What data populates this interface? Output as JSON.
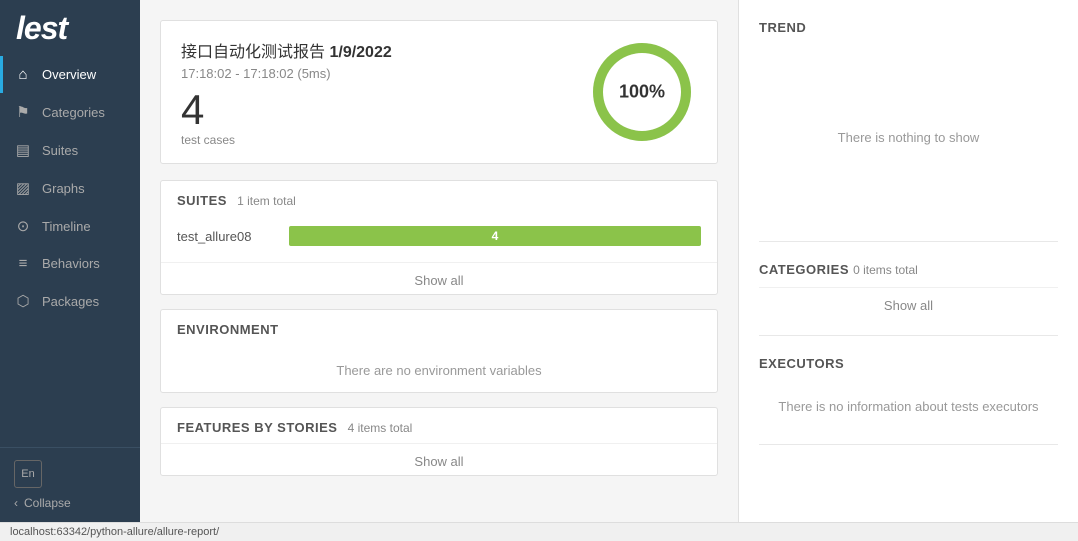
{
  "logo": {
    "text": "lest"
  },
  "sidebar": {
    "items": [
      {
        "id": "overview",
        "label": "Overview",
        "icon": "⌂",
        "active": true
      },
      {
        "id": "categories",
        "label": "Categories",
        "icon": "⚑",
        "active": false
      },
      {
        "id": "suites",
        "label": "Suites",
        "icon": "▤",
        "active": false
      },
      {
        "id": "graphs",
        "label": "Graphs",
        "icon": "▨",
        "active": false
      },
      {
        "id": "timeline",
        "label": "Timeline",
        "icon": "⊙",
        "active": false
      },
      {
        "id": "behaviors",
        "label": "Behaviors",
        "icon": "≡",
        "active": false
      },
      {
        "id": "packages",
        "label": "Packages",
        "icon": "⬡",
        "active": false
      }
    ],
    "lang_label": "En",
    "collapse_label": "Collapse"
  },
  "report": {
    "title": "接口自动化测试报告",
    "date": "1/9/2022",
    "time_range": "17:18:02 - 17:18:02 (5ms)",
    "test_count": "4",
    "test_cases_label": "test cases",
    "pass_percent": "100%"
  },
  "suites": {
    "title": "SUITES",
    "count_label": "1 item total",
    "rows": [
      {
        "name": "test_allure08",
        "value": 4,
        "max": 4
      }
    ],
    "show_all_label": "Show all"
  },
  "environment": {
    "title": "ENVIRONMENT",
    "empty_message": "There are no environment variables"
  },
  "features": {
    "title": "FEATURES BY STORIES",
    "count_label": "4 items total",
    "show_all_label": "Show all"
  },
  "trend": {
    "title": "TREND",
    "empty_message": "There is nothing to show"
  },
  "categories": {
    "title": "CATEGORIES",
    "count_label": "0 items total",
    "show_all_label": "Show all"
  },
  "executors": {
    "title": "EXECUTORS",
    "empty_message": "There is no information about tests executors"
  },
  "status_bar": {
    "url": "localhost:63342/python-allure/allure-report/"
  },
  "colors": {
    "pass": "#8bc34a",
    "accent": "#29abe2",
    "sidebar_bg": "#2c3e50"
  }
}
